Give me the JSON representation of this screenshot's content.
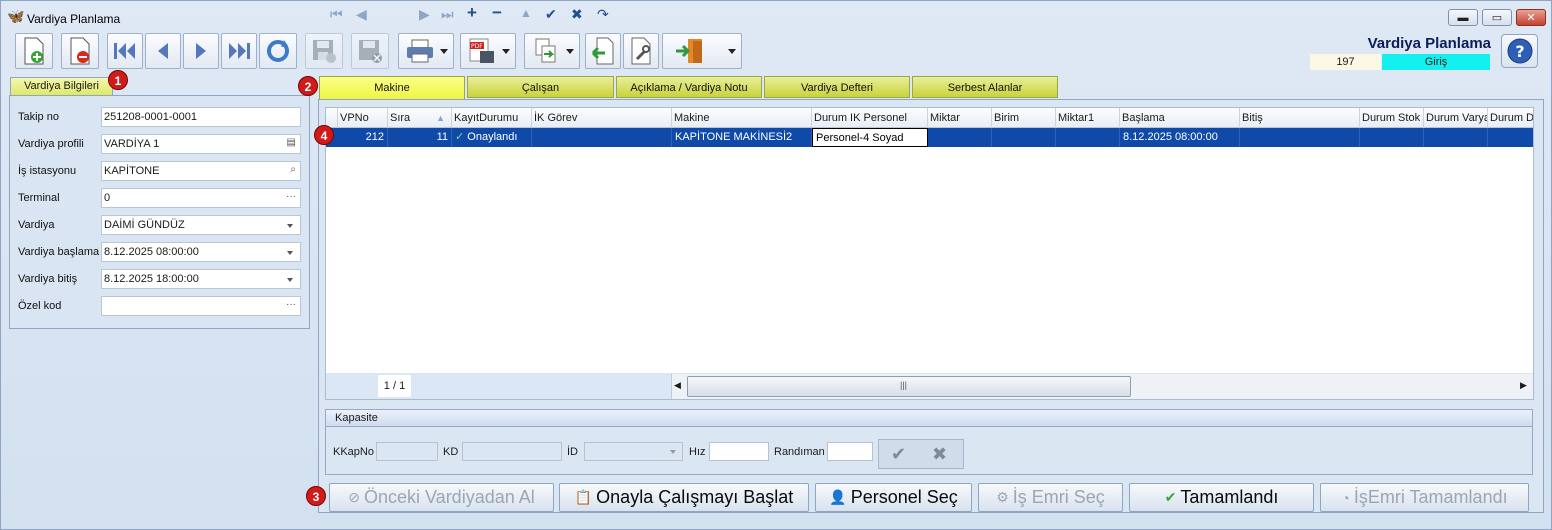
{
  "window": {
    "title": "Vardiya Planlama",
    "minimize": "▬",
    "maximize": "▭",
    "close": "✕"
  },
  "header": {
    "title": "Vardiya Planlama",
    "record_number": "197",
    "mode": "Giriş"
  },
  "left_panel": {
    "tab": "Vardiya Bilgileri",
    "fields": [
      {
        "label": "Takip no",
        "value": "251208-0001-0001"
      },
      {
        "label": "Vardiya profili",
        "value": "VARDİYA 1"
      },
      {
        "label": "İş istasyonu",
        "value": "KAPİTONE"
      },
      {
        "label": "Terminal",
        "value": "0"
      },
      {
        "label": "Vardiya",
        "value": "DAİMİ GÜNDÜZ"
      },
      {
        "label": "Vardiya başlama",
        "value": "8.12.2025 08:00:00"
      },
      {
        "label": "Vardiya bitiş",
        "value": "8.12.2025 18:00:00"
      },
      {
        "label": "Özel kod",
        "value": ""
      }
    ]
  },
  "tabs": [
    "Makine",
    "Çalışan",
    "Açıklama / Vardiya Notu",
    "Vardiya Defteri",
    "Serbest Alanlar"
  ],
  "grid": {
    "columns": [
      "VPNo",
      "Sıra",
      "KayıtDurumu",
      "İK Görev",
      "Makine",
      "Durum IK Personel",
      "Miktar",
      "Birim",
      "Miktar1",
      "Başlama",
      "Bitiş",
      "Durum Stok",
      "Durum Varya",
      "Durum DS"
    ],
    "rows": [
      {
        "VPNo": "212",
        "Sira": "11",
        "KayitDurumu": "Onaylandı",
        "IKGorev": "",
        "Makine": "KAPİTONE MAKİNESİ2",
        "DurumIKPersonel": "Personel-4 Soyad",
        "Miktar": "",
        "Birim": "",
        "Miktar1": "",
        "Baslama": "8.12.2025 08:00:00",
        "Bitis": "",
        "DurumStok": "",
        "DurumVarya": "",
        "DurumDS": ""
      }
    ],
    "pager": "1 / 1"
  },
  "kapasite": {
    "title": "Kapasite",
    "labels": {
      "kkapno": "KKapNo",
      "kd": "KD",
      "id": "İD",
      "hiz": "Hız",
      "randiman": "Randıman"
    }
  },
  "buttons": {
    "onceki": "Önceki Vardiyadan Al",
    "onayla": "Onayla Çalışmayı Başlat",
    "personel": "Personel Seç",
    "isemri": "İş Emri Seç",
    "tamamlandi": "Tamamlandı",
    "isemri_tamam": "İşEmri Tamamlandı"
  },
  "badges": [
    "1",
    "2",
    "3",
    "4"
  ],
  "colors": {
    "tab_active": "#eef542",
    "selected_row": "#0f4aa8",
    "mode_bg": "#13f0f0",
    "badge": "#d01b1b"
  }
}
